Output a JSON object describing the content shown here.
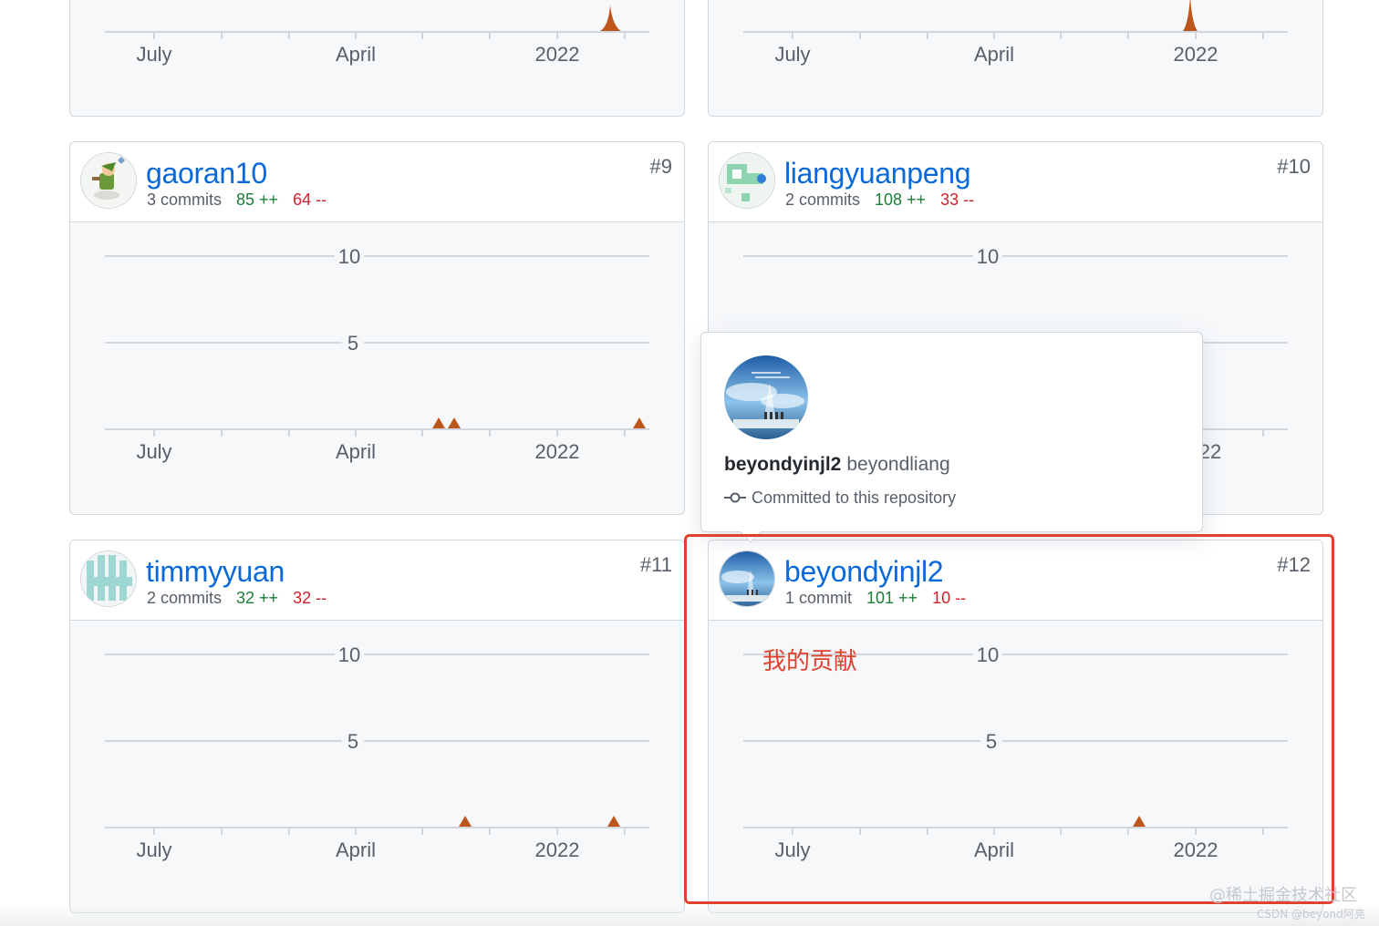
{
  "colors": {
    "link": "#0969da",
    "additions": "#1a7f37",
    "deletions": "#cf222e",
    "spike": "#bd561d",
    "annotation": "#e0412e"
  },
  "x_axis": [
    "July",
    "April",
    "2022"
  ],
  "y_axis": [
    "10",
    "5"
  ],
  "cards": [
    {
      "rank": "",
      "username": "",
      "commits": "",
      "additions": "",
      "deletions": "",
      "chart_data": {
        "type": "area",
        "x_ticks": [
          "July",
          "April",
          "2022"
        ],
        "spikes": [
          {
            "position": "late 2021",
            "height": "small"
          }
        ]
      }
    },
    {
      "rank": "",
      "username": "",
      "commits": "",
      "additions": "",
      "deletions": "",
      "chart_data": {
        "type": "area",
        "x_ticks": [
          "July",
          "April",
          "2022"
        ],
        "spikes": [
          {
            "position": "early 2022",
            "height": "small"
          }
        ]
      }
    },
    {
      "rank": "#9",
      "username": "gaoran10",
      "commits": "3 commits",
      "additions": "85 ++",
      "deletions": "64 --",
      "chart_data": {
        "type": "area",
        "x_ticks": [
          "July",
          "April",
          "2022"
        ],
        "y_ticks": [
          "10",
          "5"
        ],
        "spike_count": 3
      }
    },
    {
      "rank": "#10",
      "username": "liangyuanpeng",
      "commits": "2 commits",
      "additions": "108 ++",
      "deletions": "33 --",
      "chart_data": {
        "type": "area",
        "x_ticks": [
          "July",
          "April",
          "2022"
        ],
        "y_ticks": [
          "10",
          "5"
        ]
      }
    },
    {
      "rank": "#11",
      "username": "timmyyuan",
      "commits": "2 commits",
      "additions": "32 ++",
      "deletions": "32 --",
      "chart_data": {
        "type": "area",
        "x_ticks": [
          "July",
          "April",
          "2022"
        ],
        "y_ticks": [
          "10",
          "5"
        ],
        "spike_count": 2
      }
    },
    {
      "rank": "#12",
      "username": "beyondyinjl2",
      "commits": "1 commit",
      "additions": "101 ++",
      "deletions": "10 --",
      "chart_data": {
        "type": "area",
        "x_ticks": [
          "July",
          "April",
          "2022"
        ],
        "y_ticks": [
          "10",
          "5"
        ],
        "spike_count": 1
      }
    }
  ],
  "popover": {
    "login": "beyondyinjl2",
    "fullname": "beyondliang",
    "note": "Committed to this repository",
    "partial_tick": "22"
  },
  "annotation": "我的贡献",
  "watermark": {
    "line1": "@稀土掘金技术社区",
    "line2": "CSDN @beyond阿亮"
  }
}
